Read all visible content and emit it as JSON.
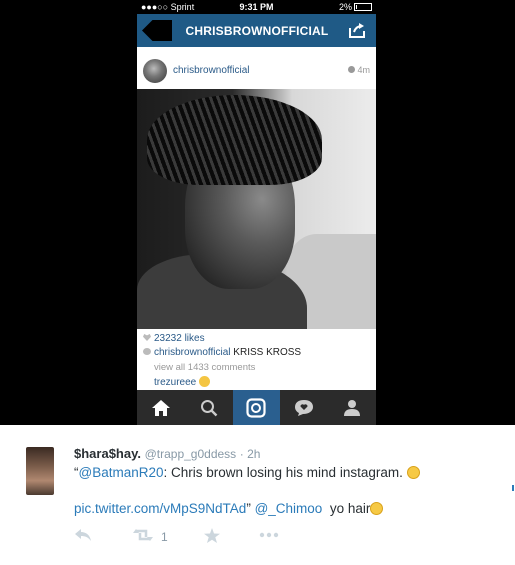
{
  "status_bar": {
    "carrier": "●●●○○ Sprint",
    "time": "9:31 PM",
    "battery": "2%",
    "icons": [
      "wifi-icon",
      "bluetooth-icon",
      "battery-icon"
    ]
  },
  "nav": {
    "title": "CHRISBROWNOFFICIAL",
    "icons": [
      "back-icon",
      "share-icon"
    ]
  },
  "post": {
    "username": "chrisbrownofficial",
    "time_ago": "4m",
    "likes": "23232 likes",
    "caption_user": "chrisbrownofficial",
    "caption_text": "KRISS KROSS",
    "view_all": "view all 1433 comments",
    "commenter": "trezureee"
  },
  "tabbar": {
    "tabs": [
      "home-icon",
      "search-icon",
      "camera-icon",
      "activity-icon",
      "profile-icon"
    ],
    "active_index": 2
  },
  "tweet": {
    "name": "$hara$hay.",
    "handle": "@trapp_g0ddess",
    "time": "· 2h",
    "open_quote": "“",
    "mention": "@BatmanR20",
    "text1": ": Chris brown losing his mind instagram.",
    "link": "pic.twitter.com/vMpS9NdTAd",
    "close_quote": "”",
    "mention2": "@_Chimoo",
    "text2": "yo hair",
    "retweet_count": "1"
  },
  "colors": {
    "instagram_blue": "#1f5a86",
    "twitter_link": "#2b7bb9"
  }
}
